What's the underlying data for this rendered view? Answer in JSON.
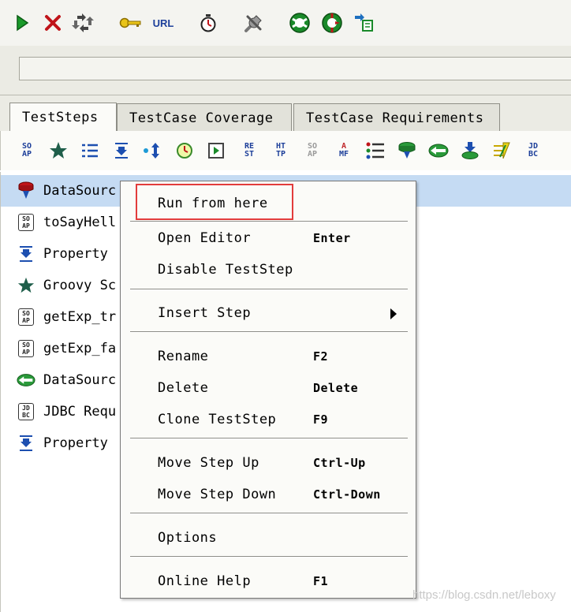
{
  "toolbar": {
    "url_label": "URL",
    "icons": [
      "run-icon",
      "cancel-icon",
      "loop-icon",
      "key-icon",
      "url-icon",
      "timer-icon",
      "tools-icon",
      "help-icon",
      "run-options-icon",
      "add-step-icon"
    ]
  },
  "tabs": [
    {
      "label": "TestSteps",
      "active": true
    },
    {
      "label": "TestCase Coverage",
      "active": false
    },
    {
      "label": "TestCase Requirements",
      "active": false
    }
  ],
  "step_toolbar": {
    "soap": [
      "SO",
      "AP"
    ],
    "rest": [
      "RE",
      "ST"
    ],
    "http": [
      "HT",
      "TP"
    ],
    "soap_mock": [
      "SO",
      "AP"
    ],
    "amf": [
      "A",
      "MF"
    ],
    "jdbc": [
      "JD",
      "BC"
    ]
  },
  "steps": [
    {
      "label": "DataSourc",
      "icon": "datasource-icon",
      "selected": true
    },
    {
      "label": "toSayHell",
      "icon": "soap-request-icon",
      "selected": false
    },
    {
      "label": "Property",
      "icon": "property-transfer-icon",
      "selected": false
    },
    {
      "label": "Groovy Sc",
      "icon": "groovy-script-icon",
      "selected": false
    },
    {
      "label": "getExp_tr",
      "icon": "soap-request-icon",
      "selected": false
    },
    {
      "label": "getExp_fa",
      "icon": "soap-request-icon",
      "selected": false
    },
    {
      "label": "DataSourc",
      "icon": "datasource-loop-icon",
      "selected": false
    },
    {
      "label": "JDBC Requ",
      "icon": "jdbc-request-icon",
      "selected": false
    },
    {
      "label": "Property",
      "icon": "property-transfer-icon",
      "selected": false
    }
  ],
  "soap_icon_text": [
    "SO",
    "AP"
  ],
  "jdbc_icon_text": [
    "JD",
    "BC"
  ],
  "context_menu": {
    "run_from_here": "Run from here",
    "open_editor": {
      "label": "Open Editor",
      "shortcut": "Enter"
    },
    "disable_teststep": "Disable TestStep",
    "insert_step": "Insert Step",
    "rename": {
      "label": "Rename",
      "shortcut": "F2"
    },
    "delete": {
      "label": "Delete",
      "shortcut": "Delete"
    },
    "clone_teststep": {
      "label": "Clone TestStep",
      "shortcut": "F9"
    },
    "move_up": {
      "label": "Move Step Up",
      "shortcut": "Ctrl-Up"
    },
    "move_down": {
      "label": "Move Step Down",
      "shortcut": "Ctrl-Down"
    },
    "options": "Options",
    "online_help": {
      "label": "Online Help",
      "shortcut": "F1"
    }
  },
  "colors": {
    "selection": "#c5dbf3",
    "highlight_box": "#e23c3c",
    "icon_blue": "#1d3f9a"
  },
  "watermark": "https://blog.csdn.net/leboxy"
}
